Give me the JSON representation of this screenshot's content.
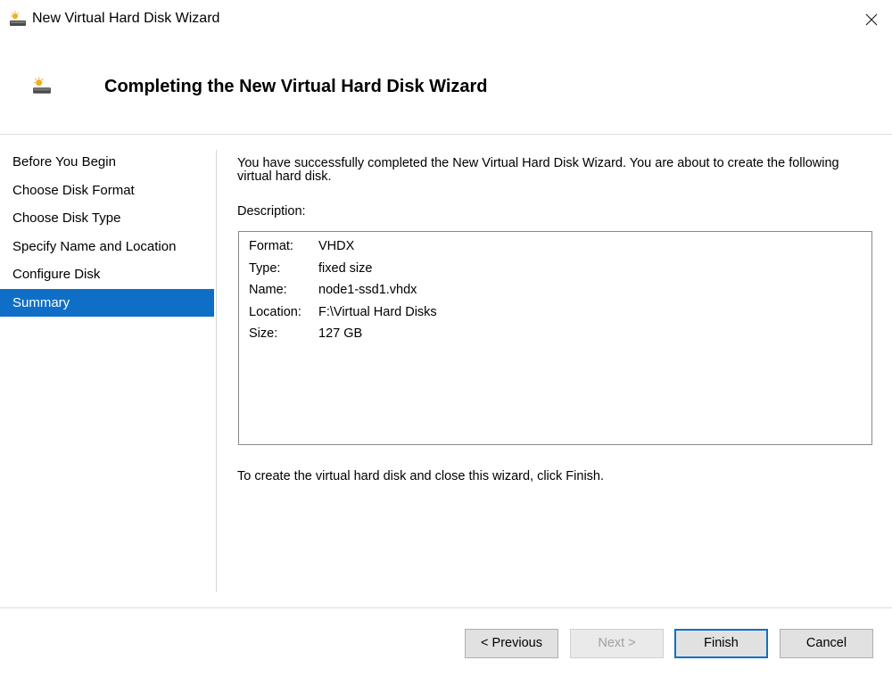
{
  "window": {
    "title": "New Virtual Hard Disk Wizard",
    "close_glyph": "✕"
  },
  "header": {
    "title": "Completing the New Virtual Hard Disk Wizard",
    "icon": "virtual-disk-icon"
  },
  "nav": {
    "items": [
      {
        "label": "Before You Begin"
      },
      {
        "label": "Choose Disk Format"
      },
      {
        "label": "Choose Disk Type"
      },
      {
        "label": "Specify Name and Location"
      },
      {
        "label": "Configure Disk"
      },
      {
        "label": "Summary"
      }
    ],
    "active_index": 5
  },
  "main": {
    "intro": "You have successfully completed the New Virtual Hard Disk Wizard. You are about to create the following virtual hard disk.",
    "description_label": "Description:",
    "description": [
      {
        "key": "Format:",
        "value": "VHDX"
      },
      {
        "key": "Type:",
        "value": "fixed size"
      },
      {
        "key": "Name:",
        "value": "node1-ssd1.vhdx"
      },
      {
        "key": "Location:",
        "value": "F:\\Virtual Hard Disks"
      },
      {
        "key": "Size:",
        "value": "127 GB"
      }
    ],
    "finish_note": "To create the virtual hard disk and close this wizard, click Finish."
  },
  "buttons": {
    "previous": "< Previous",
    "next": "Next >",
    "finish": "Finish",
    "cancel": "Cancel"
  },
  "colors": {
    "accent": "#0f6fc6",
    "disabled_text": "#a0a0a0"
  }
}
